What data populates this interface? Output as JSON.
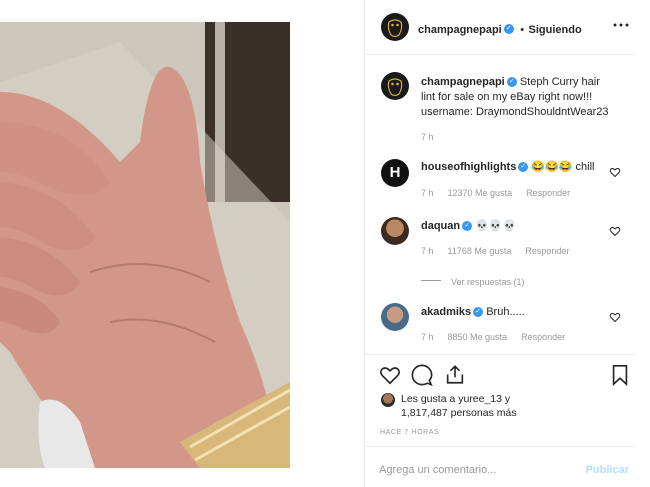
{
  "post": {
    "author": "champagnepapi",
    "separator": "•",
    "follow_status": "Siguiendo",
    "more_icon": "ellipsis-icon"
  },
  "caption": {
    "username": "champagnepapi",
    "text": "Steph Curry hair lint for sale on my eBay right now!!! username: DraymondShouldntWear23",
    "time": "7 h"
  },
  "comments": [
    {
      "username": "houseofhighlights",
      "text": "😂😂😂 chill",
      "time": "7 h",
      "likes": "12370 Me gusta",
      "reply": "Responder",
      "avatar": "H"
    },
    {
      "username": "daquan",
      "text": "💀💀💀",
      "time": "7 h",
      "likes": "11768 Me gusta",
      "reply": "Responder"
    },
    {
      "username": "akadmiks",
      "text": "Bruh.....",
      "time": "7 h",
      "likes": "8850 Me gusta",
      "reply": "Responder"
    }
  ],
  "view_replies": "Ver respuestas (1)",
  "likes": {
    "line1": "Les gusta a yuree_13 y",
    "line2": "1,817,487 personas más"
  },
  "timestamp": "HACE 7 HORAS",
  "comment_box": {
    "placeholder": "Agrega un comentario...",
    "submit": "Publicar"
  },
  "colors": {
    "verified": "#3897f0",
    "publish_disabled": "#b2dffc",
    "muted": "#999999"
  }
}
